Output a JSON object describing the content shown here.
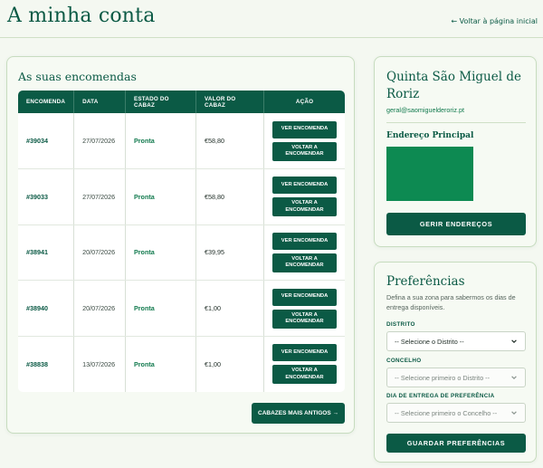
{
  "header": {
    "title": "A minha conta",
    "back_link": "← Voltar à página inicial"
  },
  "orders": {
    "title": "As suas encomendas",
    "columns": [
      "ENCOMENDA",
      "DATA",
      "ESTADO DO CABAZ",
      "VALOR DO CABAZ",
      "AÇÃO"
    ],
    "view_label": "VER ENCOMENDA",
    "reorder_label": "VOLTAR A ENCOMENDAR",
    "rows": [
      {
        "id": "#39034",
        "date": "27/07/2026",
        "status": "Pronta",
        "value": "€58,80"
      },
      {
        "id": "#39033",
        "date": "27/07/2026",
        "status": "Pronta",
        "value": "€58,80"
      },
      {
        "id": "#38941",
        "date": "20/07/2026",
        "status": "Pronta",
        "value": "€39,95"
      },
      {
        "id": "#38940",
        "date": "20/07/2026",
        "status": "Pronta",
        "value": "€1,00"
      },
      {
        "id": "#38838",
        "date": "13/07/2026",
        "status": "Pronta",
        "value": "€1,00"
      }
    ],
    "older_button": "CABAZES MAIS ANTIGOS →"
  },
  "farm": {
    "name": "Quinta São Miguel de Roriz",
    "email": "geral@saomiguelderoriz.pt",
    "address_title": "Endereço Principal",
    "map_color": "#0d8a52",
    "manage_button": "GERIR ENDEREÇOS"
  },
  "preferences": {
    "title": "Preferências",
    "description": "Defina a sua zona para sabermos os dias de entrega disponíveis.",
    "district_label": "DISTRITO",
    "district_value": "-- Selecione o Distrito --",
    "county_label": "CONCELHO",
    "county_value": "-- Selecione primeiro o Distrito --",
    "delivery_label": "DIA DE ENTREGA DE PREFERÊNCIA",
    "delivery_value": "-- Selecione primeiro o Concelho --",
    "save_button": "GUARDAR PREFERÊNCIAS"
  },
  "colors": {
    "brand": "#0b5a45",
    "status": "#127a4e",
    "background": "#f4f8f1"
  }
}
